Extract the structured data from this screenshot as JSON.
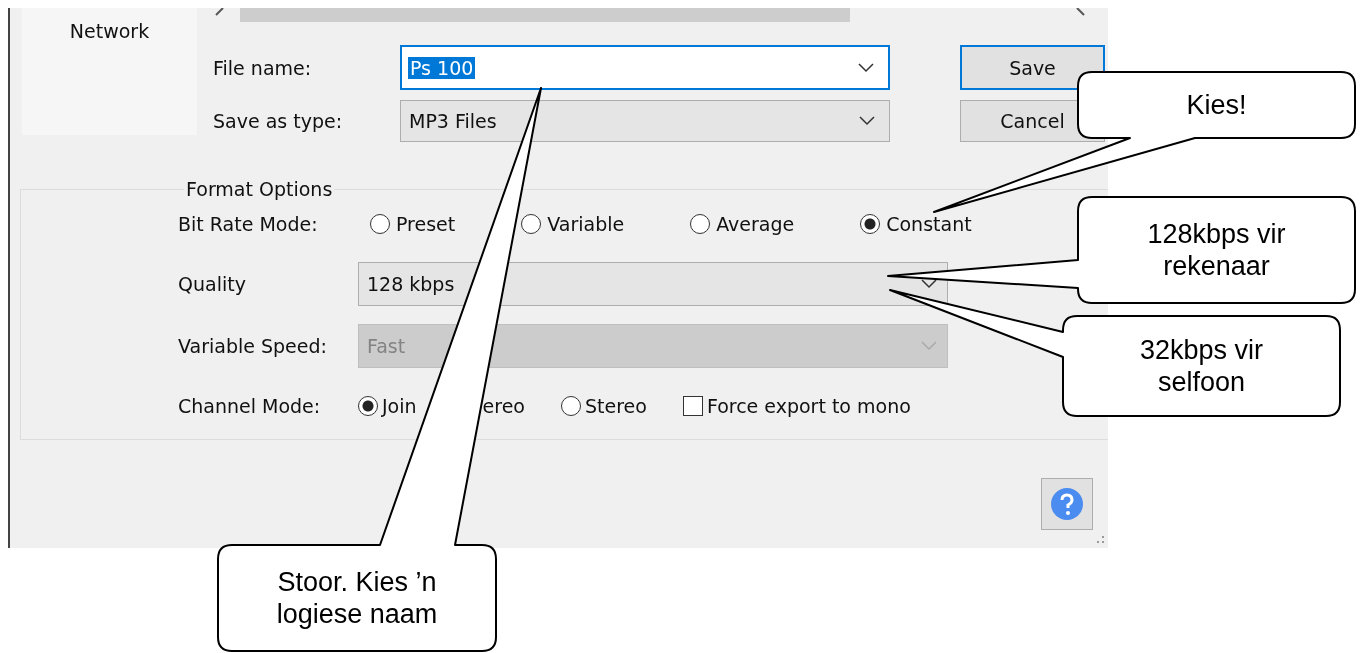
{
  "sidebar": {
    "items": [
      {
        "label": "Network"
      }
    ]
  },
  "file_name": {
    "label": "File name:",
    "value": "Ps 100",
    "text_selected": true
  },
  "save_as_type": {
    "label": "Save as type:",
    "value": "MP3 Files"
  },
  "buttons": [
    {
      "label": "Save",
      "default": true
    },
    {
      "label": "Cancel",
      "default": false
    }
  ],
  "format_options": {
    "title": "Format Options",
    "bit_rate_mode": {
      "label": "Bit Rate Mode:",
      "options": [
        {
          "label": "Preset",
          "selected": false
        },
        {
          "label": "Variable",
          "selected": false
        },
        {
          "label": "Average",
          "selected": false
        },
        {
          "label": "Constant",
          "selected": true
        }
      ]
    },
    "quality": {
      "label": "Quality",
      "value": "128 kbps",
      "disabled": false
    },
    "variable_speed": {
      "label": "Variable Speed:",
      "value": "Fast",
      "disabled": true
    },
    "channel_mode": {
      "label": "Channel Mode:",
      "options": [
        {
          "label_parts": [
            "Join",
            "ereo"
          ],
          "selected": true
        },
        {
          "label": "Stereo",
          "selected": false
        }
      ],
      "force_mono": {
        "label": "Force export to mono",
        "checked": false
      }
    }
  },
  "callouts": [
    {
      "lines": [
        "Kies!"
      ]
    },
    {
      "lines": [
        "128kbps vir",
        "rekenaar"
      ]
    },
    {
      "lines": [
        "32kbps vir",
        "selfoon"
      ]
    },
    {
      "lines": [
        "Stoor. Kies ’n",
        "logiese naam"
      ]
    }
  ]
}
